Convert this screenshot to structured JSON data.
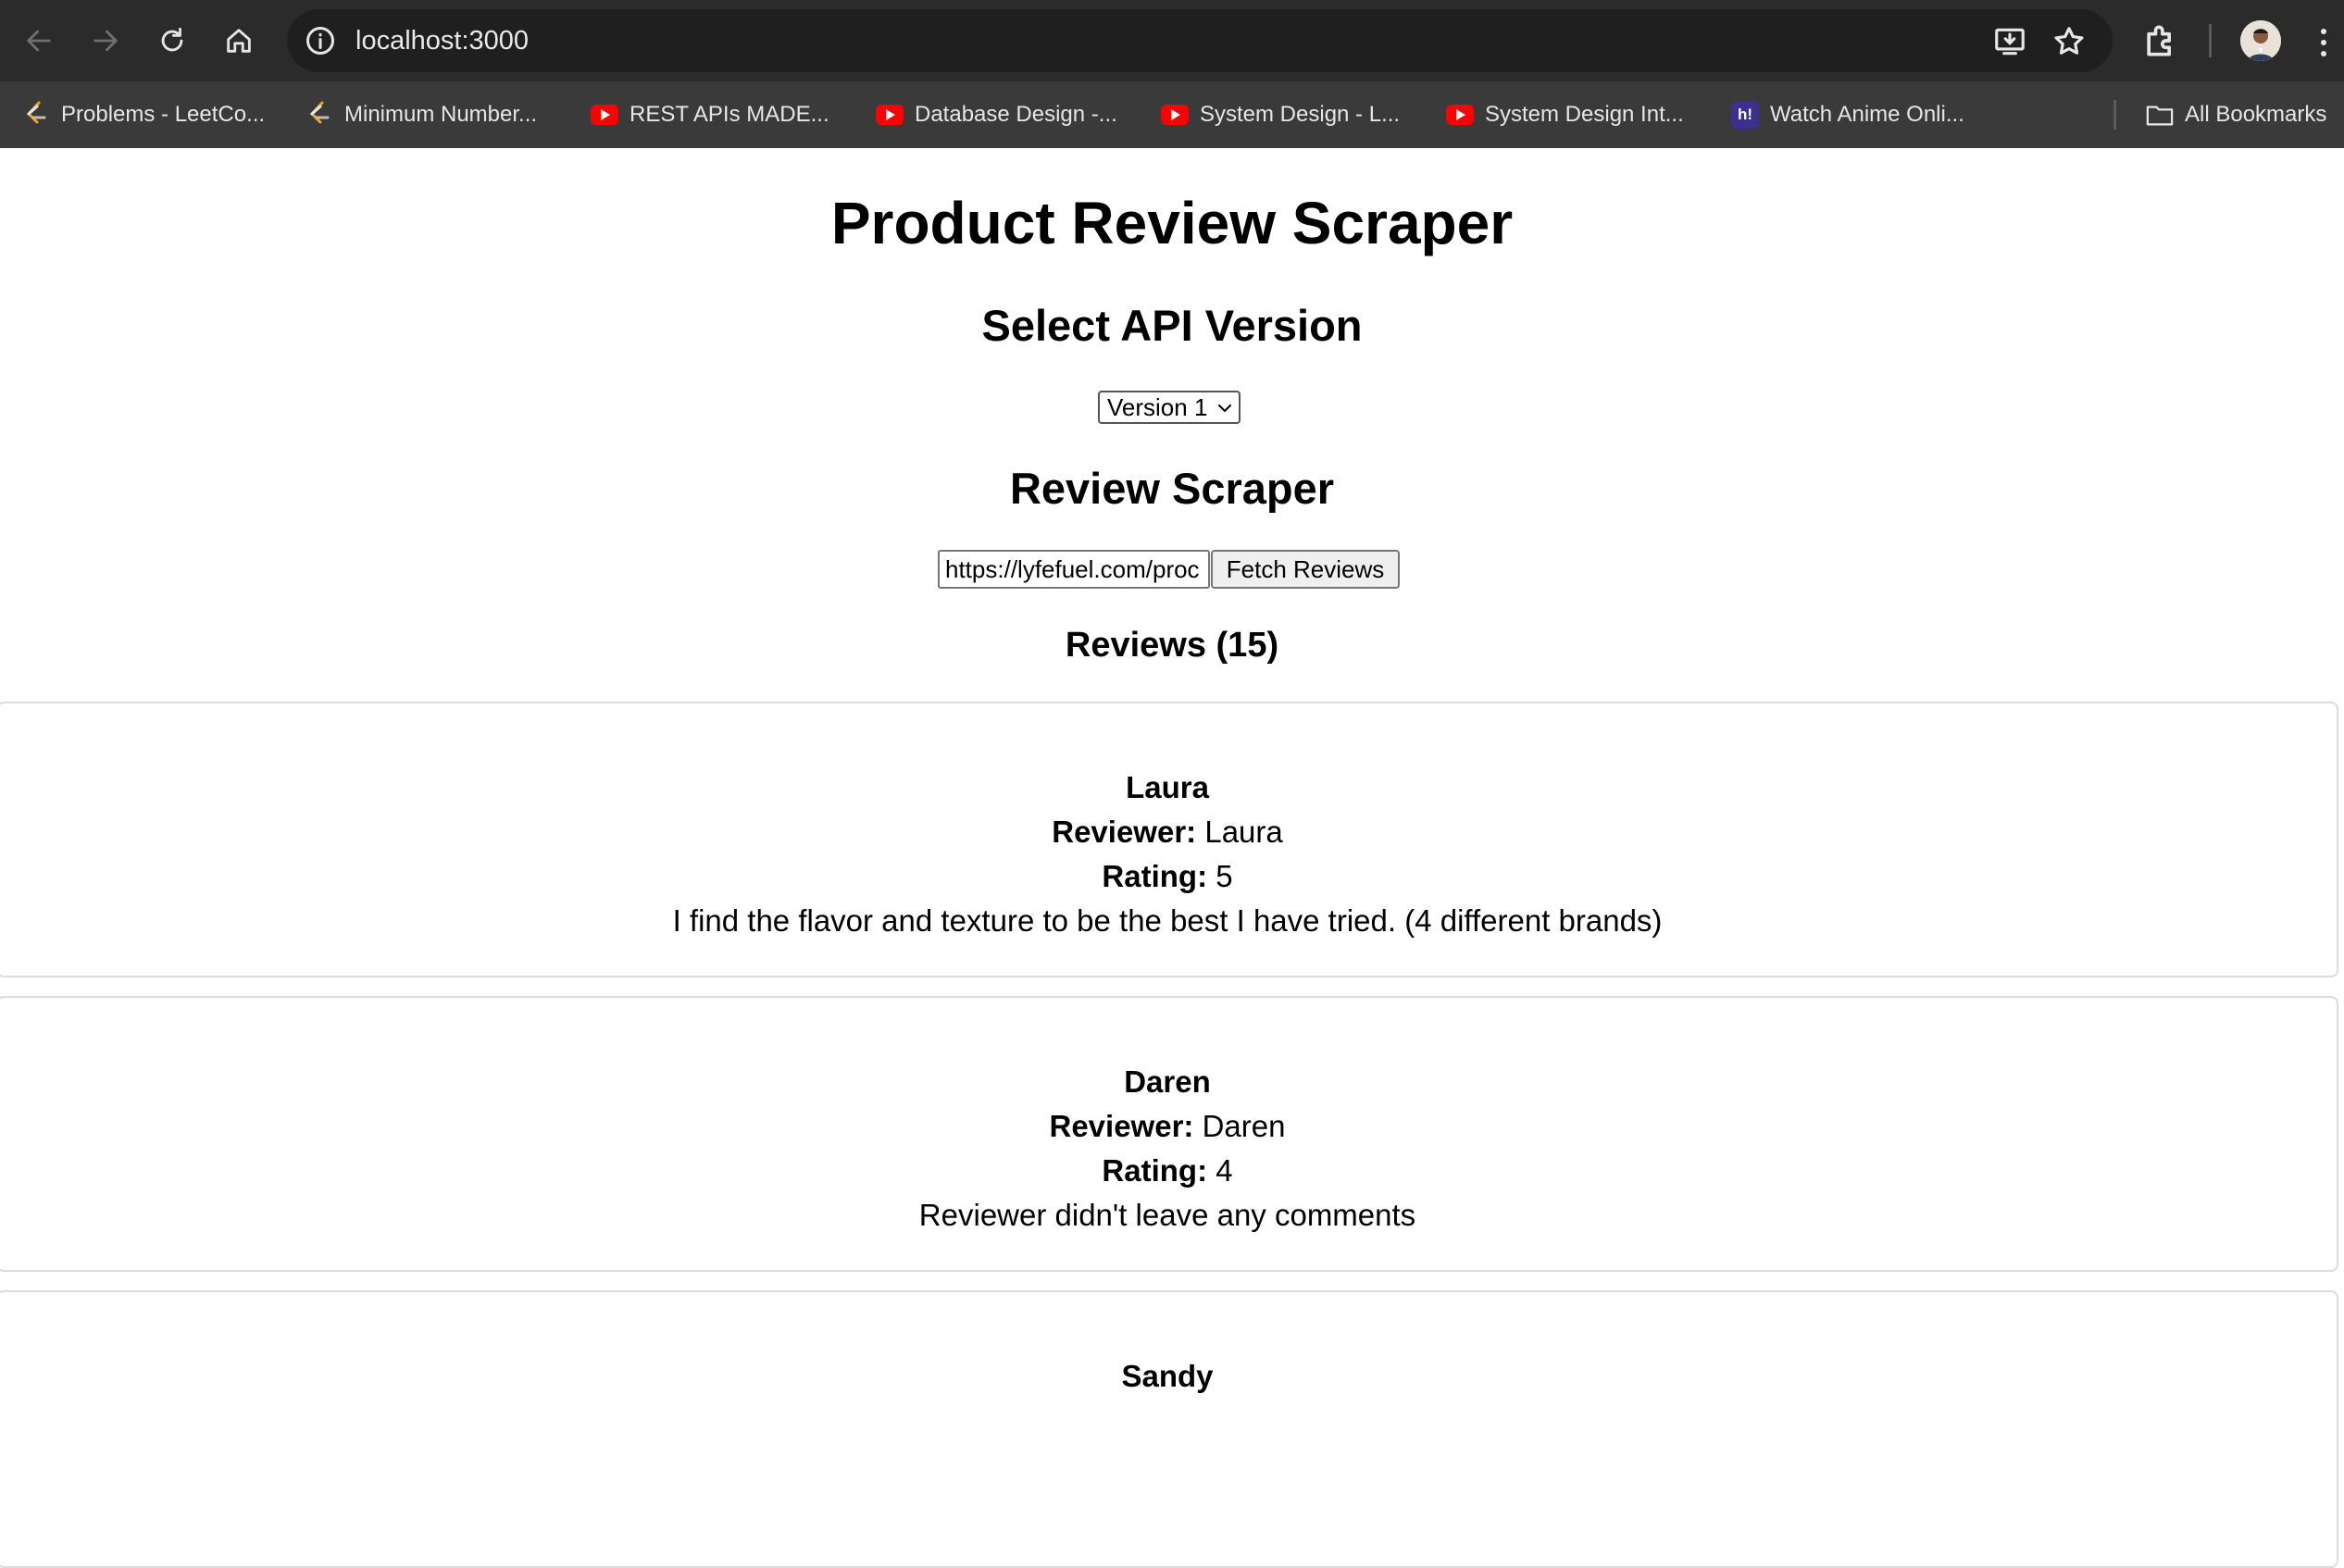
{
  "browser": {
    "url": "localhost:3000",
    "bookmarks": [
      {
        "label": "Problems - LeetCo...",
        "icon": "leetcode-icon"
      },
      {
        "label": "Minimum Number...",
        "icon": "leetcode-icon"
      },
      {
        "label": "REST APIs MADE...",
        "icon": "youtube-icon"
      },
      {
        "label": "Database Design -...",
        "icon": "youtube-icon"
      },
      {
        "label": "System Design - L...",
        "icon": "youtube-icon"
      },
      {
        "label": "System Design Int...",
        "icon": "youtube-icon"
      },
      {
        "label": "Watch Anime Onli...",
        "icon": "hianime-icon"
      },
      {
        "label": "All Bookmarks",
        "icon": "folder-icon"
      }
    ]
  },
  "page": {
    "title": "Product Review Scraper",
    "api_heading": "Select API Version",
    "api_select_value": "Version 1",
    "scraper_heading": "Review Scraper",
    "url_input_value": "https://lyfefuel.com/proc",
    "fetch_button": "Fetch Reviews",
    "reviews_heading": "Reviews (15)"
  },
  "labels": {
    "reviewer": "Reviewer:",
    "rating": "Rating:"
  },
  "reviews": [
    {
      "name": "Laura",
      "reviewer": "Laura",
      "rating": "5",
      "text": "I find the flavor and texture to be the best I have tried. (4 different brands)"
    },
    {
      "name": "Daren",
      "reviewer": "Daren",
      "rating": "4",
      "text": "Reviewer didn't leave any comments"
    },
    {
      "name": "Sandy"
    }
  ],
  "colors": {
    "toolbar_bg": "#2b2b2c",
    "bookmarks_bg": "#3a3a3b",
    "card_border": "#dcdcdc"
  }
}
